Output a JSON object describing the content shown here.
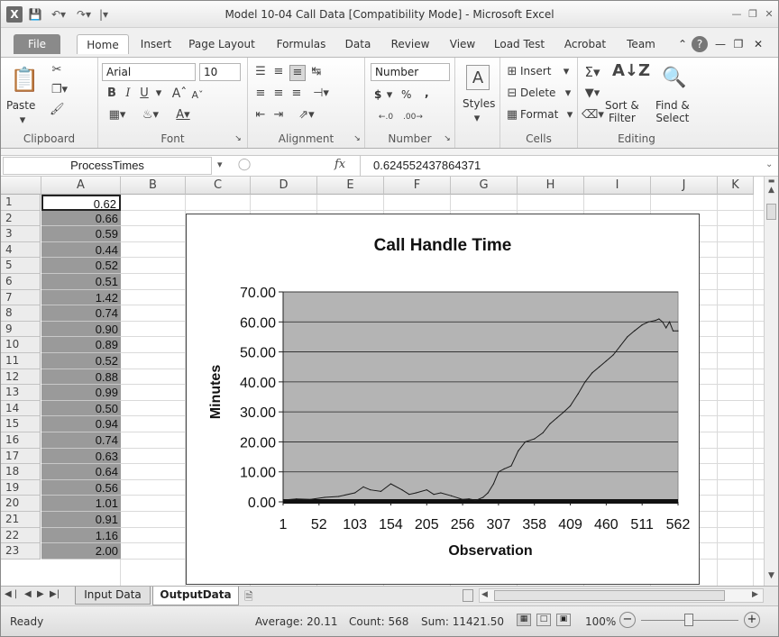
{
  "window": {
    "title": "Model 10-04 Call Data  [Compatibility Mode]  -  Microsoft Excel",
    "app_icon": "excel-icon"
  },
  "ribbon_tabs": [
    "File",
    "Home",
    "Insert",
    "Page Layout",
    "Formulas",
    "Data",
    "Review",
    "View",
    "Load Test",
    "Acrobat",
    "Team"
  ],
  "ribbon": {
    "clipboard": {
      "label": "Clipboard",
      "paste": "Paste"
    },
    "font": {
      "label": "Font",
      "name": "Arial",
      "size": "10"
    },
    "alignment": {
      "label": "Alignment"
    },
    "number": {
      "label": "Number",
      "format": "Number",
      "currency": "$",
      "percent": "%",
      "comma": ","
    },
    "styles": {
      "label": "Styles"
    },
    "cells": {
      "label": "Cells",
      "insert": "Insert",
      "delete": "Delete",
      "format": "Format"
    },
    "editing": {
      "label": "Editing",
      "sort": "Sort &\nFilter",
      "find": "Find &\nSelect"
    }
  },
  "formula_bar": {
    "name_box": "ProcessTimes",
    "fx": "fx",
    "value": "0.624552437864371"
  },
  "columns": [
    "A",
    "B",
    "C",
    "D",
    "E",
    "F",
    "G",
    "H",
    "I",
    "J",
    "K"
  ],
  "rows": [
    {
      "n": "1",
      "a": "0.62"
    },
    {
      "n": "2",
      "a": "0.66"
    },
    {
      "n": "3",
      "a": "0.59"
    },
    {
      "n": "4",
      "a": "0.44"
    },
    {
      "n": "5",
      "a": "0.52"
    },
    {
      "n": "6",
      "a": "0.51"
    },
    {
      "n": "7",
      "a": "1.42"
    },
    {
      "n": "8",
      "a": "0.74"
    },
    {
      "n": "9",
      "a": "0.90"
    },
    {
      "n": "10",
      "a": "0.89"
    },
    {
      "n": "11",
      "a": "0.52"
    },
    {
      "n": "12",
      "a": "0.88"
    },
    {
      "n": "13",
      "a": "0.99"
    },
    {
      "n": "14",
      "a": "0.50"
    },
    {
      "n": "15",
      "a": "0.94"
    },
    {
      "n": "16",
      "a": "0.74"
    },
    {
      "n": "17",
      "a": "0.63"
    },
    {
      "n": "18",
      "a": "0.64"
    },
    {
      "n": "19",
      "a": "0.56"
    },
    {
      "n": "20",
      "a": "1.01"
    },
    {
      "n": "21",
      "a": "0.91"
    },
    {
      "n": "22",
      "a": "1.16"
    },
    {
      "n": "23",
      "a": "2.00"
    }
  ],
  "sheet_tabs": [
    "Input Data",
    "OutputData"
  ],
  "active_sheet": "OutputData",
  "status": {
    "ready": "Ready",
    "average": "Average: 20.11",
    "count": "Count: 568",
    "sum": "Sum: 11421.50",
    "zoom": "100%"
  },
  "chart_data": {
    "type": "line",
    "title": "Call Handle Time",
    "xlabel": "Observation",
    "ylabel": "Minutes",
    "ylim": [
      0,
      70
    ],
    "yticks": [
      "0.00",
      "10.00",
      "20.00",
      "30.00",
      "40.00",
      "50.00",
      "60.00",
      "70.00"
    ],
    "xticks": [
      "1",
      "52",
      "103",
      "154",
      "205",
      "256",
      "307",
      "358",
      "409",
      "460",
      "511",
      "562"
    ],
    "grid": true,
    "plot_bg": "#b4b4b4",
    "series": [
      {
        "x": [
          1,
          20,
          40,
          60,
          80,
          103,
          115,
          125,
          140,
          154,
          170,
          180,
          190,
          205,
          215,
          225,
          240,
          256,
          265,
          275,
          285,
          292,
          300,
          307,
          315,
          325,
          335,
          345,
          358,
          370,
          380,
          390,
          400,
          409,
          420,
          430,
          440,
          450,
          460,
          470,
          480,
          490,
          500,
          511,
          520,
          530,
          535,
          540,
          545,
          550,
          555,
          562
        ],
        "y": [
          0.6,
          1.0,
          0.8,
          1.5,
          1.8,
          3.0,
          5.0,
          4.0,
          3.5,
          6.0,
          4.0,
          2.5,
          3.0,
          4.0,
          2.5,
          3.0,
          2.0,
          0.8,
          1.0,
          0.5,
          1.5,
          3.0,
          6.0,
          10.0,
          11.0,
          12.0,
          17.0,
          20.0,
          21.0,
          23.0,
          26.0,
          28.0,
          30.0,
          32.0,
          36.0,
          40.0,
          43.0,
          45.0,
          47.0,
          49.0,
          52.0,
          55.0,
          57.0,
          59.0,
          60.0,
          60.5,
          61.0,
          60.0,
          58.0,
          60.0,
          57.0,
          57.0
        ]
      }
    ]
  }
}
